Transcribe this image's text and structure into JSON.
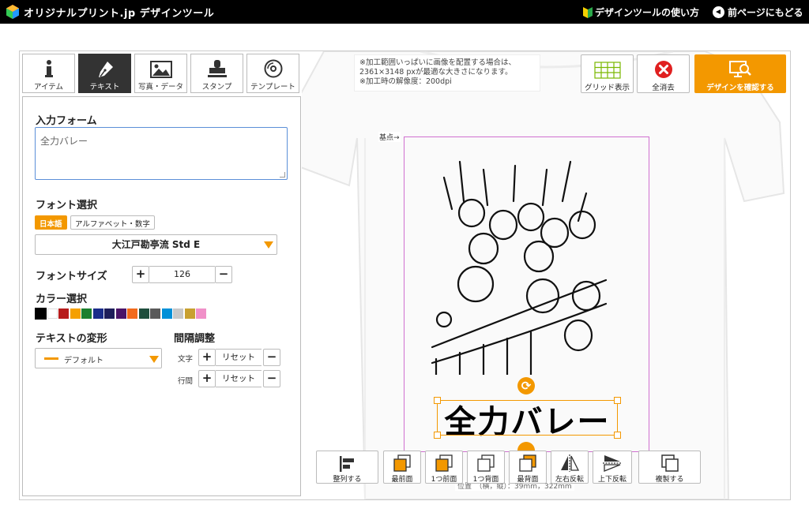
{
  "header": {
    "logo_text": "オリジナルプリント.jp デザインツール",
    "help_link": "デザインツールの使い方",
    "back_link": "前ページにもどる"
  },
  "tabs": [
    {
      "label": "アイテム",
      "icon": "info-icon"
    },
    {
      "label": "テキスト",
      "icon": "pen-icon",
      "active": true
    },
    {
      "label": "写真・データ",
      "icon": "image-icon"
    },
    {
      "label": "スタンプ",
      "icon": "stamp-icon"
    },
    {
      "label": "テンプレート",
      "icon": "disc-icon"
    }
  ],
  "panel": {
    "input_form_title": "入力フォーム",
    "input_value": "全力バレー",
    "font_select_title": "フォント選択",
    "lang_japanese": "日本語",
    "lang_alphanumeric": "アルファベット・数字",
    "font_name": "大江戸勘亭流 Std E",
    "font_size_title": "フォントサイズ",
    "font_size_value": "126",
    "color_title": "カラー選択",
    "colors": [
      "#000000",
      "#ffffff",
      "#b71c1c",
      "#f5a000",
      "#1b7f2e",
      "#1a2c8a",
      "#1e1e5a",
      "#4a1468",
      "#f26a1b",
      "#1f4e3d",
      "#5a5a5a",
      "#0090d8",
      "#c8c8c8",
      "#c8a030",
      "#f090c8"
    ],
    "selected_color_index": 0,
    "warp_title": "テキストの変形",
    "warp_value": "デフォルト",
    "spacing_title": "間隔調整",
    "char_label": "文字",
    "line_label": "行間",
    "reset_label": "リセット"
  },
  "canvas": {
    "note_lines": [
      "※加工範囲いっぱいに画像を配置する場合は、",
      "2361×3148 pxが最適な大きさになります。",
      "※加工時の解像度：200dpi"
    ],
    "base_point_label": "基点→",
    "text": "全力バレー",
    "position_readout": "位置　（横，縦）：39mm，322mm"
  },
  "actions": {
    "grid": "グリッド表示",
    "clear_all": "全消去",
    "confirm": "デザインを確認する"
  },
  "toolbar": [
    {
      "label": "整列する",
      "icon": "align-icon"
    },
    {
      "label": "最前面",
      "icon": "bring-to-front-icon"
    },
    {
      "label": "1つ前面",
      "icon": "bring-forward-icon"
    },
    {
      "label": "1つ背面",
      "icon": "send-backward-icon"
    },
    {
      "label": "最背面",
      "icon": "send-to-back-icon"
    },
    {
      "label": "左右反転",
      "icon": "flip-horizontal-icon"
    },
    {
      "label": "上下反転",
      "icon": "flip-vertical-icon"
    },
    {
      "label": "複製する",
      "icon": "duplicate-icon"
    }
  ],
  "colors": {
    "accent": "#f39800",
    "print_area": "#d070d0"
  }
}
